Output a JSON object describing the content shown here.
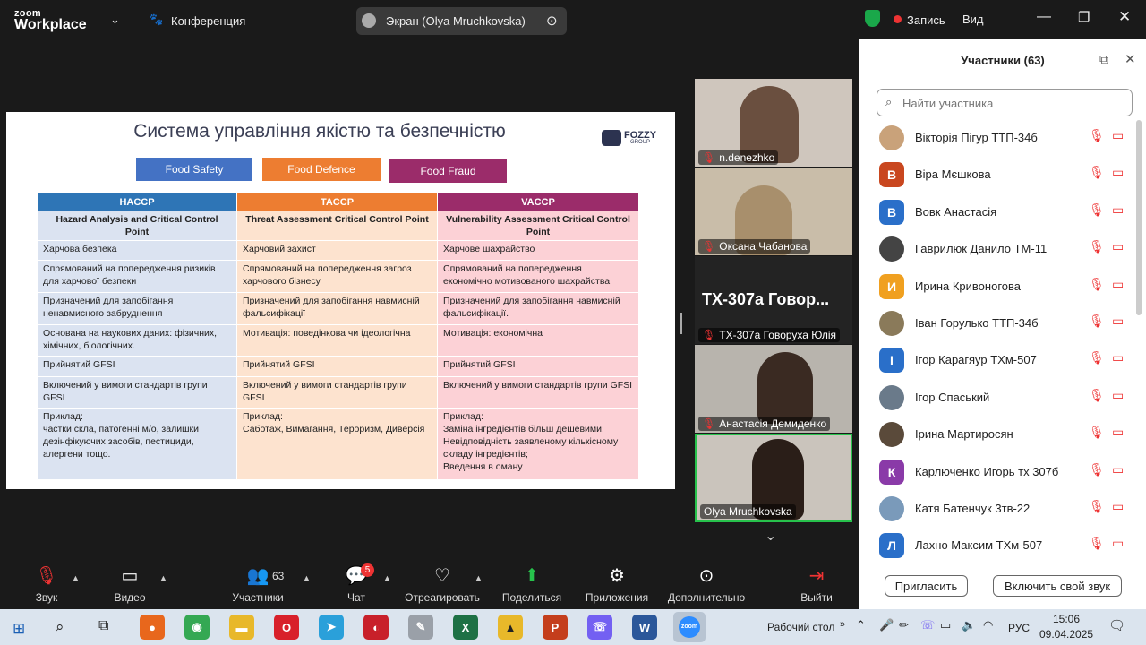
{
  "topbar": {
    "logo_top": "zoom",
    "logo_bottom": "Workplace",
    "meeting": "Конференция",
    "screen": "Экран (Olya Mruchkovska)",
    "record": "Запись",
    "view": "Вид"
  },
  "slide": {
    "title": "Система управління якістю та безпечністю",
    "brand": "FOZZY",
    "brand_sub": "GROUP",
    "tags": [
      "Food Safety",
      "Food Defence",
      "Food Fraud"
    ],
    "headers": [
      "HACCP",
      "TACCP",
      "VACCP"
    ],
    "subheaders": [
      "Hazard Analysis and Critical Control Point",
      "Threat Assessment Critical Control Point",
      "Vulnerability Assessment Critical Control Point"
    ],
    "rows": [
      [
        "Харчова безпека",
        "Харчовий захист",
        "Харчове шахрайство"
      ],
      [
        "Спрямований на попередження ризиків для харчової безпеки",
        "Спрямований на попередження загроз харчового бізнесу",
        "Спрямований на попередження економічно мотивованого шахрайства"
      ],
      [
        "Призначений для запобігання ненавмисного забруднення",
        "Призначений для запобігання навмисній фальсифікації",
        "Призначений для запобігання навмисній фальсифікації."
      ],
      [
        "Основана на наукових даних: фізичних, хімічних, біологічних.",
        "Мотивація: поведінкова чи ідеологічна",
        "Мотивація: економічна"
      ],
      [
        "Прийнятий GFSI",
        "Прийнятий GFSI",
        "Прийнятий GFSI"
      ],
      [
        "Включений у вимоги стандартів групи GFSI",
        "Включений у вимоги стандартів групи GFSI",
        "Включений у вимоги стандартів групи GFSI"
      ],
      [
        "Приклад:\nчастки скла, патогенні м/о, залишки дезінфікуючих засобів, пестициди, алергени тощо.",
        "Приклад:\nСаботаж, Вимагання, Тероризм, Диверсія",
        "Приклад:\nЗаміна інгредієнтів більш дешевими;\nНевідповідність заявленому кількісному складу інгредієнтів;\nВведення в оману"
      ]
    ]
  },
  "tiles": [
    {
      "name": "n.denezhko"
    },
    {
      "name": "Оксана Чабанова"
    },
    {
      "name": "ТХ-307а Говоруха Юлія",
      "big": "ТХ-307а  Говор..."
    },
    {
      "name": "Анастасія Демиденко"
    },
    {
      "name": "Olya Mruchkovska"
    }
  ],
  "panel": {
    "title": "Участники (63)",
    "search_placeholder": "Найти участника",
    "invite": "Пригласить",
    "unmute": "Включить свой звук",
    "participants": [
      {
        "name": "Вікторія Пігур ТТП-34б",
        "initial": "",
        "color": "#c9a27a"
      },
      {
        "name": "Віра Мєшкова",
        "initial": "В",
        "color": "#c9471f"
      },
      {
        "name": "Вовк Анастасія",
        "initial": "В",
        "color": "#2a6fc9"
      },
      {
        "name": "Гаврилюк Данило ТМ-11",
        "initial": "",
        "color": "#444444"
      },
      {
        "name": "Ирина Кривоногова",
        "initial": "И",
        "color": "#f0a020"
      },
      {
        "name": "Іван Горулько ТТП-34б",
        "initial": "",
        "color": "#8a7a5a"
      },
      {
        "name": "Ігор Карагяур ТХм-507",
        "initial": "І",
        "color": "#2a6fc9"
      },
      {
        "name": "Ігор Спаський",
        "initial": "",
        "color": "#6a7a8a"
      },
      {
        "name": "Ірина Мартиросян",
        "initial": "",
        "color": "#5a4a3a"
      },
      {
        "name": "Карлюченко Игорь тх 307б",
        "initial": "К",
        "color": "#8a3aa8"
      },
      {
        "name": "Катя Батенчук 3тв-22",
        "initial": "",
        "color": "#7a9aba"
      },
      {
        "name": "Лахно Максим ТХм-507",
        "initial": "Л",
        "color": "#2a6fc9"
      }
    ]
  },
  "toolbar": {
    "mute": "Звук",
    "video": "Видео",
    "participants": "Участники",
    "participants_count": "63",
    "chat": "Чат",
    "chat_badge": "5",
    "react": "Отреагировать",
    "share": "Поделиться",
    "apps": "Приложения",
    "more": "Дополнительно",
    "leave": "Выйти"
  },
  "taskbar": {
    "desktop": "Рабочий стол",
    "lang": "РУС",
    "time": "15:06",
    "date": "09.04.2025"
  }
}
